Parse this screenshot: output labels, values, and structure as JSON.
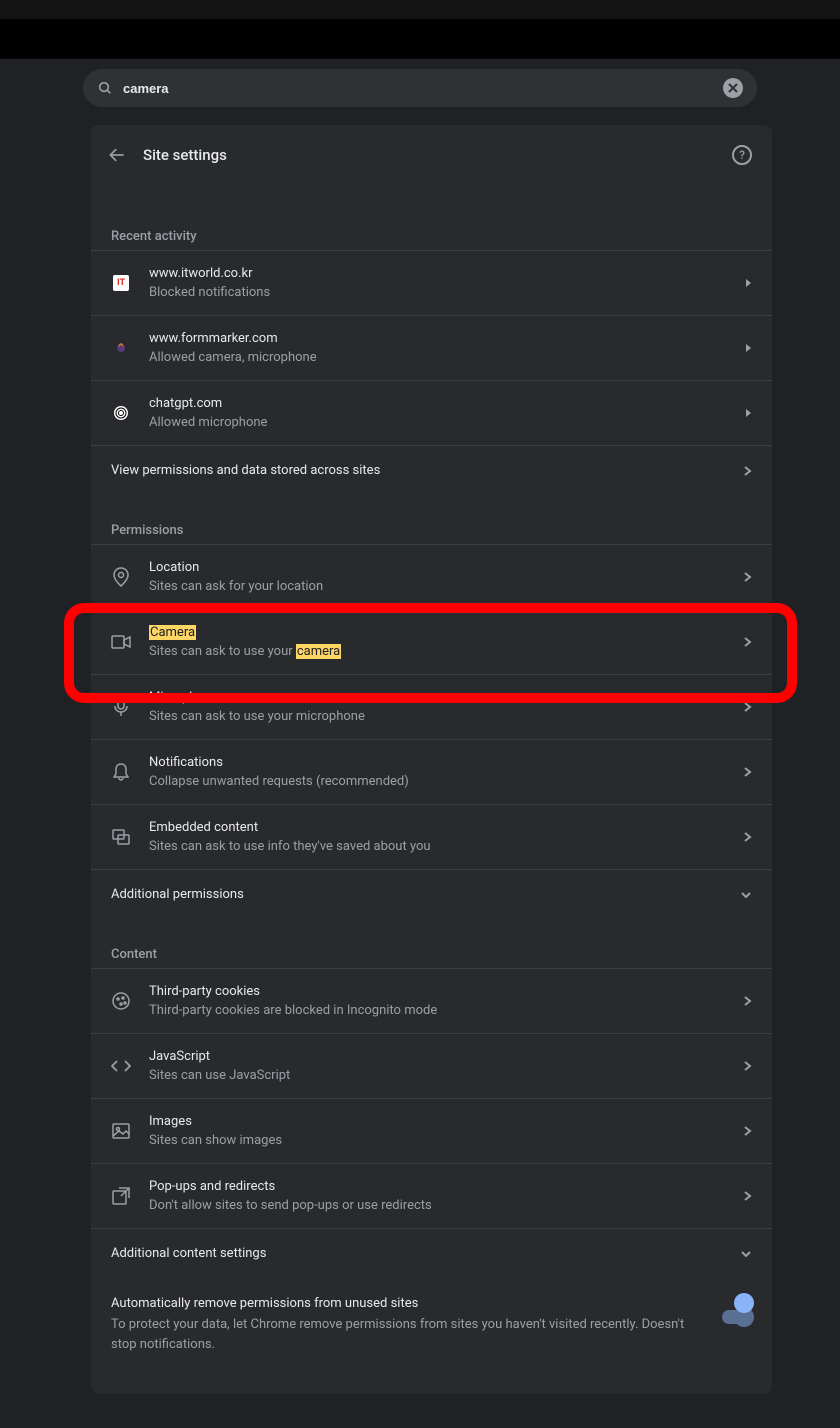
{
  "search": {
    "query": "camera"
  },
  "header": {
    "title": "Site settings"
  },
  "recent": {
    "label": "Recent activity",
    "items": [
      {
        "site": "www.itworld.co.kr",
        "status": "Blocked notifications",
        "favicon": "IT"
      },
      {
        "site": "www.formmarker.com",
        "status": "Allowed camera, microphone",
        "favicon": ""
      },
      {
        "site": "chatgpt.com",
        "status": "Allowed microphone",
        "favicon": ""
      }
    ],
    "viewAll": "View permissions and data stored across sites"
  },
  "permissions": {
    "label": "Permissions",
    "items": [
      {
        "title": "Location",
        "sub": "Sites can ask for your location",
        "icon": "location"
      },
      {
        "title": "Camera",
        "sub_pre": "Sites can ask to use your ",
        "sub_hl": "camera",
        "icon": "camera",
        "highlighted": true
      },
      {
        "title": "Microphone",
        "sub": "Sites can ask to use your microphone",
        "icon": "mic"
      },
      {
        "title": "Notifications",
        "sub": "Collapse unwanted requests (recommended)",
        "icon": "bell"
      },
      {
        "title": "Embedded content",
        "sub": "Sites can ask to use info they've saved about you",
        "icon": "embed"
      }
    ],
    "additional": "Additional permissions"
  },
  "content": {
    "label": "Content",
    "items": [
      {
        "title": "Third-party cookies",
        "sub": "Third-party cookies are blocked in Incognito mode",
        "icon": "cookie"
      },
      {
        "title": "JavaScript",
        "sub": "Sites can use JavaScript",
        "icon": "code"
      },
      {
        "title": "Images",
        "sub": "Sites can show images",
        "icon": "image"
      },
      {
        "title": "Pop-ups and redirects",
        "sub": "Don't allow sites to send pop-ups or use redirects",
        "icon": "popup"
      }
    ],
    "additional": "Additional content settings"
  },
  "autoRemove": {
    "title": "Automatically remove permissions from unused sites",
    "desc": "To protect your data, let Chrome remove permissions from sites you haven't visited recently. Doesn't stop notifications."
  }
}
